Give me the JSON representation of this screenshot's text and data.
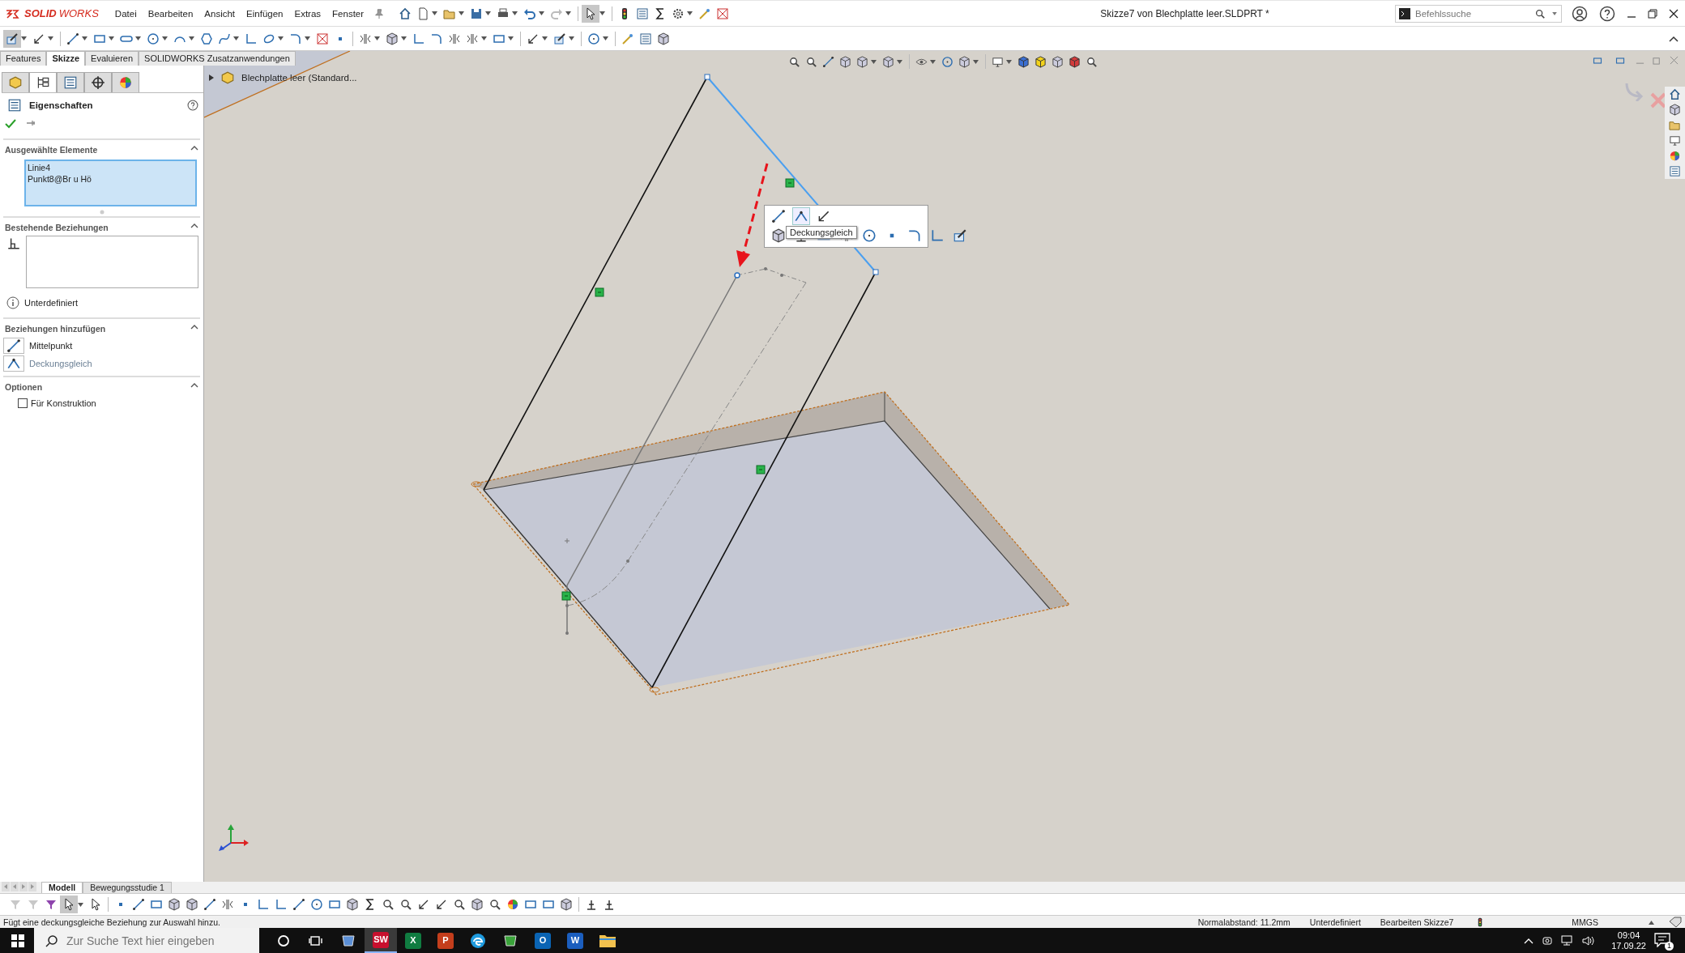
{
  "app": {
    "logo": "**SOLID**WORKS"
  },
  "menu": [
    "Datei",
    "Bearbeiten",
    "Ansicht",
    "Einfügen",
    "Extras",
    "Fenster"
  ],
  "window": {
    "title": "Skizze7 von Blechplatte leer.SLDPRT *"
  },
  "search": {
    "placeholder": "Befehlssuche"
  },
  "command_tabs": [
    {
      "label": "Features",
      "selected": false
    },
    {
      "label": "Skizze",
      "selected": true
    },
    {
      "label": "Evaluieren",
      "selected": false
    },
    {
      "label": "SOLIDWORKS Zusatzanwendungen",
      "selected": false
    }
  ],
  "property_manager": {
    "panel_tabs": [
      {
        "selected": false
      },
      {
        "selected": true
      },
      {
        "selected": false
      },
      {
        "selected": false
      },
      {
        "selected": false
      }
    ],
    "title": "Eigenschaften",
    "sections": [
      {
        "kind": "selected_list",
        "title": "Ausgewählte Elemente",
        "items": [
          "Linie4",
          "Punkt8@Br u Hö"
        ]
      },
      {
        "kind": "relations",
        "title": "Bestehende Beziehungen",
        "status": "Unterdefiniert"
      },
      {
        "kind": "add_relations",
        "title": "Beziehungen hinzufügen",
        "items": [
          {
            "label": "Mittelpunkt",
            "disabled": false
          },
          {
            "label": "Deckungsgleich",
            "disabled": true
          }
        ]
      },
      {
        "kind": "options",
        "title": "Optionen",
        "options": [
          {
            "label": "Für Konstruktion",
            "checked": false
          }
        ]
      }
    ]
  },
  "viewport": {
    "tree_flyout": {
      "label": "Blechplatte leer (Standard..."
    },
    "popup": {
      "tooltip": "Deckungsgleich"
    }
  },
  "model_tabs": [
    {
      "label": "Modell",
      "selected": true
    },
    {
      "label": "Bewegungsstudie 1",
      "selected": false
    }
  ],
  "status_bar": {
    "message": "Fügt eine deckungsgleiche Beziehung zur Auswahl hinzu.",
    "fields": [
      "Normalabstand: 11.2mm",
      "Unterdefiniert",
      "Bearbeiten Skizze7"
    ],
    "units": "MMGS"
  },
  "taskbar": {
    "search_placeholder": "Zur Suche Text hier eingeben",
    "apps": [
      {
        "kind": "plain",
        "color": "#5b8fd6",
        "selected": false
      },
      {
        "kind": "letter",
        "glyph": "SW",
        "color": "#c8102e",
        "selected": true
      },
      {
        "kind": "letter",
        "glyph": "X",
        "color": "#107c41",
        "selected": false
      },
      {
        "kind": "letter",
        "glyph": "P",
        "color": "#c43e1c",
        "selected": false
      },
      {
        "kind": "edge",
        "color": "#1f9bde",
        "selected": false
      },
      {
        "kind": "plain",
        "color": "#3aa33a",
        "selected": false
      },
      {
        "kind": "letter",
        "glyph": "O",
        "color": "#0a64b4",
        "selected": false
      },
      {
        "kind": "letter",
        "glyph": "W",
        "color": "#1b5ebe",
        "selected": false
      },
      {
        "kind": "folder",
        "color": "#f2c14e",
        "selected": false
      }
    ],
    "time": "09:04",
    "date": "17.09.22",
    "notification_count": "1"
  }
}
